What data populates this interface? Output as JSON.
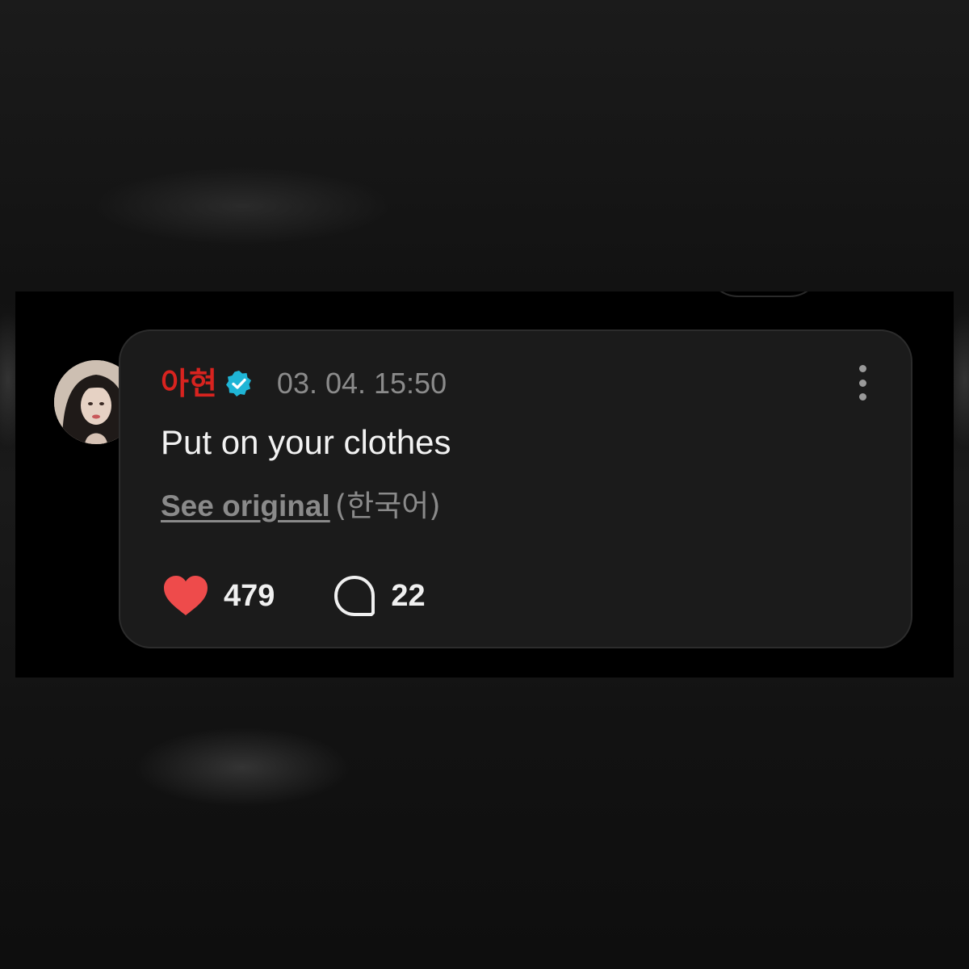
{
  "post": {
    "username": "아현",
    "verified": true,
    "timestamp": "03. 04. 15:50",
    "message": "Put on your clothes",
    "see_original_label": "See original",
    "original_language": "(한국어)",
    "likes": "479",
    "comments": "22"
  },
  "icons": {
    "verified": "verified-badge-icon",
    "menu": "more-vertical-icon",
    "like": "heart-icon",
    "comment": "speech-bubble-icon"
  },
  "colors": {
    "username": "#d8231f",
    "verified_badge": "#1fb5d6",
    "heart": "#ee4b4b",
    "card_background": "#1b1b1b",
    "muted_text": "#8a8a8a"
  }
}
